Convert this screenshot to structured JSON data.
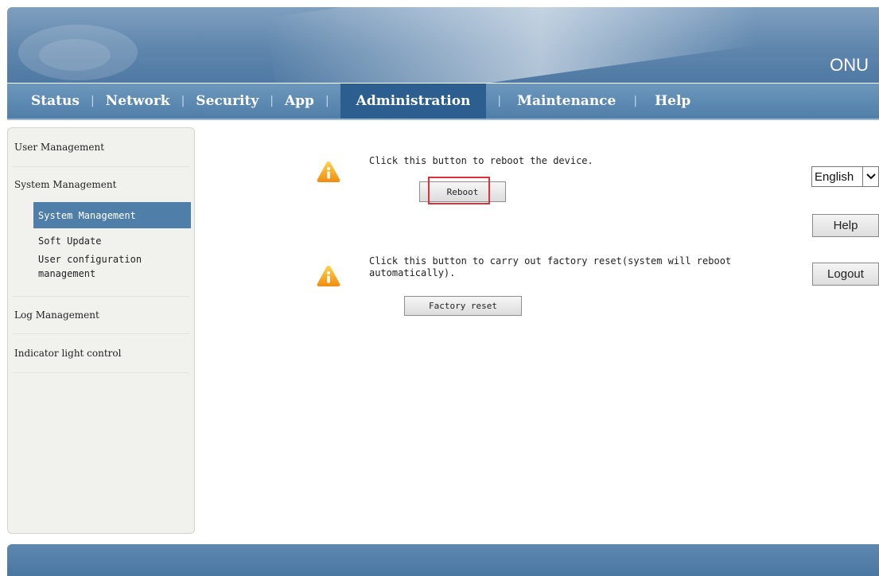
{
  "header": {
    "device_name": "ONU"
  },
  "nav": {
    "items": [
      {
        "label": "Status"
      },
      {
        "label": "Network"
      },
      {
        "label": "Security"
      },
      {
        "label": "App"
      },
      {
        "label": "Administration",
        "active": true
      },
      {
        "label": "Maintenance"
      },
      {
        "label": "Help"
      }
    ],
    "separator": "|"
  },
  "sidebar": {
    "user_management": "User Management",
    "system_management": "System Management",
    "sub_items": [
      {
        "label": "System Management",
        "active": true
      },
      {
        "label": "Soft Update"
      },
      {
        "label": "User configuration"
      },
      {
        "label": "management"
      }
    ],
    "log_management": "Log Management",
    "indicator_light_control": "Indicator light control"
  },
  "main": {
    "reboot_message": "Click this button to reboot the device.",
    "reboot_button": "Reboot",
    "factory_message_line1": "Click this button to carry out factory reset(system will reboot",
    "factory_message_line2": "automatically).",
    "factory_button": "Factory reset"
  },
  "controls": {
    "language": "English",
    "help_button": "Help",
    "logout_button": "Logout"
  },
  "colors": {
    "nav_active": "#2c5f8f",
    "sidebar_active": "#4f7ea8",
    "highlight": "#e0303a",
    "warning_icon": "#f0a020"
  }
}
